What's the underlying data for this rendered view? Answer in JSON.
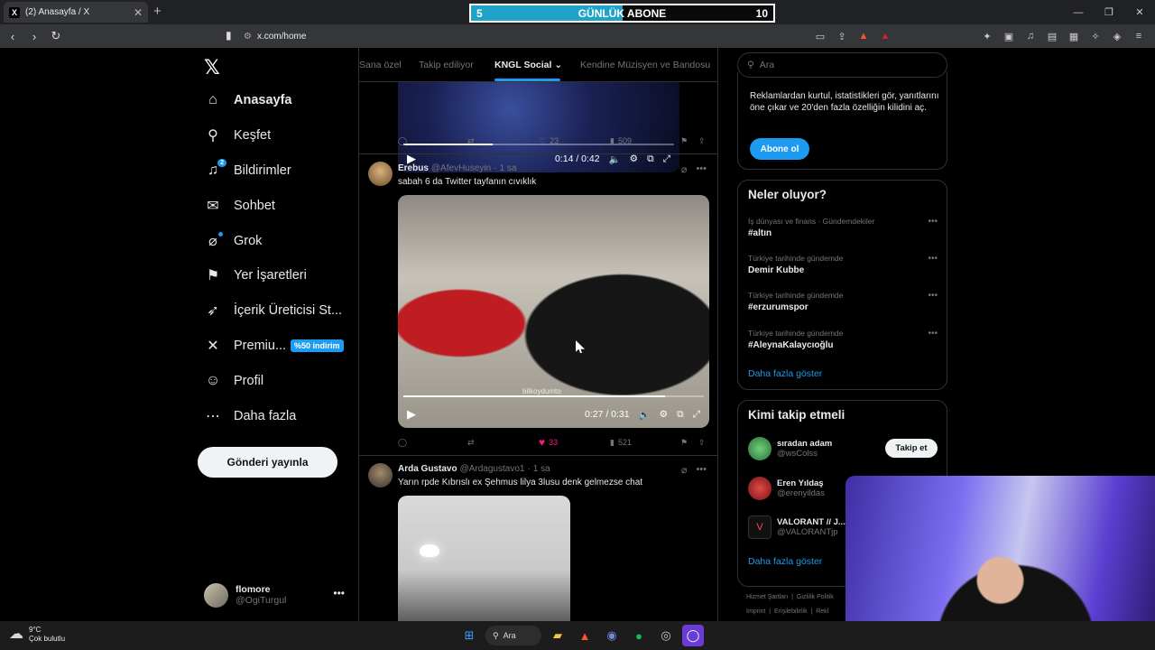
{
  "browser": {
    "tab_title": "(2) Anasayfa / X",
    "url": "x.com/home"
  },
  "overlay": {
    "left_value": "5",
    "title": "GÜNLÜK ABONE",
    "right_value": "10",
    "progress": 0.5
  },
  "nav": {
    "items": [
      {
        "label": "Anasayfa",
        "icon": "home-icon"
      },
      {
        "label": "Keşfet",
        "icon": "search-icon"
      },
      {
        "label": "Bildirimler",
        "icon": "bell-icon",
        "badge": "2"
      },
      {
        "label": "Sohbet",
        "icon": "mail-icon"
      },
      {
        "label": "Grok",
        "icon": "grok-icon"
      },
      {
        "label": "Yer İşaretleri",
        "icon": "bookmark-icon"
      },
      {
        "label": "İçerik Üreticisi St...",
        "icon": "rocket-icon"
      },
      {
        "label": "Premiu...",
        "icon": "x-icon",
        "promo": "%50 indirim"
      },
      {
        "label": "Profil",
        "icon": "person-icon"
      },
      {
        "label": "Daha fazla",
        "icon": "more-circle-icon"
      }
    ],
    "post_button": "Gönderi yayınla",
    "user_name": "flomore",
    "user_handle": "@OgiTurgul"
  },
  "feed": {
    "tabs": [
      "Sana özel",
      "Takip ediliyor",
      "KNGL Social",
      "Kendine Müzisyen ve Bandosu"
    ],
    "prev_video": {
      "time": "0:14 / 0:42",
      "progress": 0.33
    },
    "prev_actions": {
      "likes": "23",
      "views": "509"
    },
    "tweets": [
      {
        "name": "Erebus",
        "handle": "@AfevHuseyin",
        "time": "1 sa",
        "text": "sabah 6 da Twitter tayfanın cıvıklık",
        "video_time": "0:27 / 0:31",
        "video_progress": 0.87,
        "watermark": "bilkoydumto",
        "likes": "33",
        "views": "521"
      },
      {
        "name": "Arda Gustavo",
        "handle": "@Ardagustavo1",
        "time": "1 sa",
        "text": "Yarın rpde Kıbrıslı ex Şehmus lilya 3lusu denk gelmezse chat"
      }
    ]
  },
  "sidebar": {
    "search_placeholder": "Ara",
    "premium_desc": "Reklamlardan kurtul, istatistikleri gör, yanıtlarını öne çıkar ve 20'den fazla özelliğin kilidini aç.",
    "premium_button": "Abone ol",
    "trends_title": "Neler oluyor?",
    "trends": [
      {
        "category": "İş dünyası ve finans · Gündemdekiler",
        "name": "#altın"
      },
      {
        "category": "Türkiye tarihinde gündemde",
        "name": "Demir Kubbe"
      },
      {
        "category": "Türkiye tarihinde gündemde",
        "name": "#erzurumspor"
      },
      {
        "category": "Türkiye tarihinde gündemde",
        "name": "#AleynaKalaycıoğlu"
      }
    ],
    "show_more": "Daha fazla göster",
    "who_title": "Kimi takip etmeli",
    "who": [
      {
        "name": "sıradan adam",
        "handle": "@wsColss",
        "button": "Takip et"
      },
      {
        "name": "Eren Yıldaş",
        "handle": "@erenyildas"
      },
      {
        "name": "VALORANT // J...",
        "handle": "@VALORANTjp"
      }
    ],
    "footer": [
      "Hizmet Şartları",
      "Gizlilik Politik",
      "Imprint",
      "Erişilebilirlik",
      "Rekl"
    ]
  },
  "taskbar": {
    "temp": "9°C",
    "weather": "Çok bulutlu",
    "search": "Ara"
  },
  "colors": {
    "accent": "#1d9bf0",
    "like": "#f91880"
  }
}
